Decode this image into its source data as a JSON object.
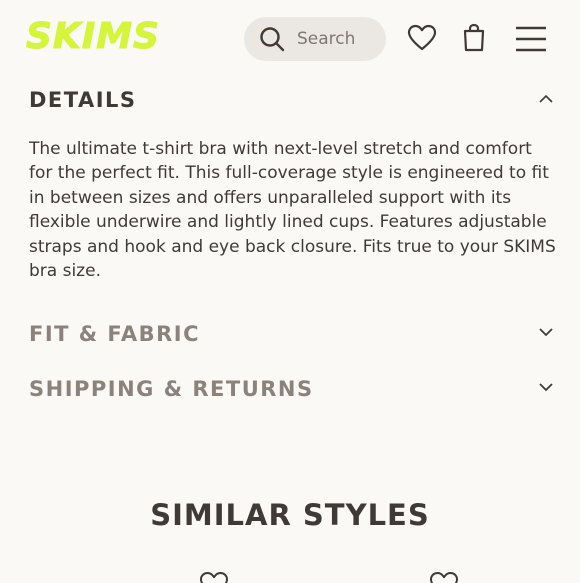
{
  "header": {
    "logo": "SKIMS",
    "search_placeholder": "Search",
    "icons": [
      "search-icon",
      "heart-icon",
      "bag-icon",
      "menu-icon"
    ]
  },
  "accordion": [
    {
      "title": "DETAILS",
      "expanded": true,
      "body": "The ultimate t-shirt bra with next-level stretch and comfort for the perfect fit. This full-coverage style is engineered to fit in between sizes and offers unparalleled support with its flexible underwire and lightly lined cups. Features adjustable straps and hook and eye back closure. Fits true to your SKIMS bra size."
    },
    {
      "title": "FIT & FABRIC",
      "expanded": false
    },
    {
      "title": "SHIPPING & RETURNS",
      "expanded": false
    }
  ],
  "similar": {
    "title": "SIMILAR STYLES"
  },
  "colors": {
    "logo": "#d4f53a",
    "text": "#3f3a36",
    "muted_title": "#8b827b",
    "background": "#fbf9f6"
  }
}
